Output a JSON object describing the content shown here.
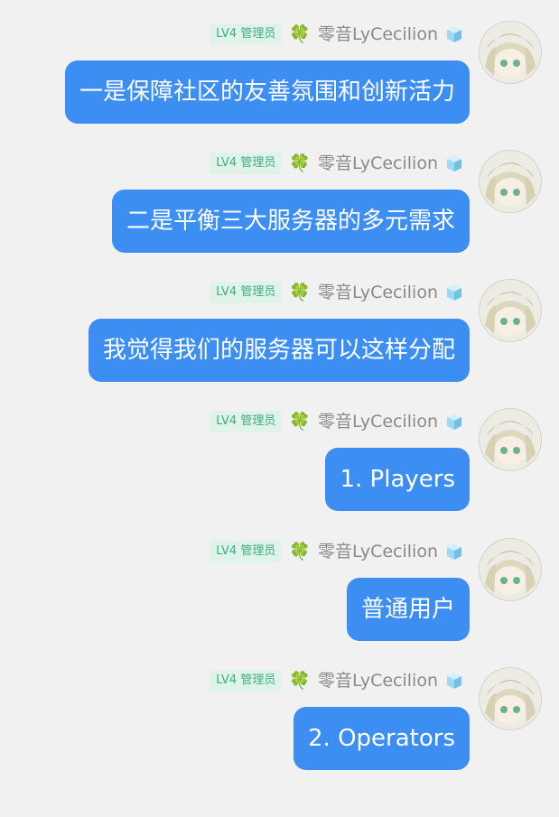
{
  "user": {
    "level_badge": "LV4 管理员",
    "name": "零音LyCecilion"
  },
  "messages": [
    {
      "text": "一是保障社区的友善氛围和创新活力"
    },
    {
      "text": "二是平衡三大服务器的多元需求"
    },
    {
      "text": "我觉得我们的服务器可以这样分配"
    },
    {
      "text": "1. Players"
    },
    {
      "text": "普通用户"
    },
    {
      "text": "2. Operators"
    }
  ],
  "colors": {
    "bubble": "#3c8ef3",
    "badge_bg": "#dff3ea",
    "badge_text": "#3fae7f",
    "background": "#f1f1f1"
  },
  "icons": {
    "clover": "four-leaf-clover-icon",
    "cube": "ice-cube-icon"
  }
}
